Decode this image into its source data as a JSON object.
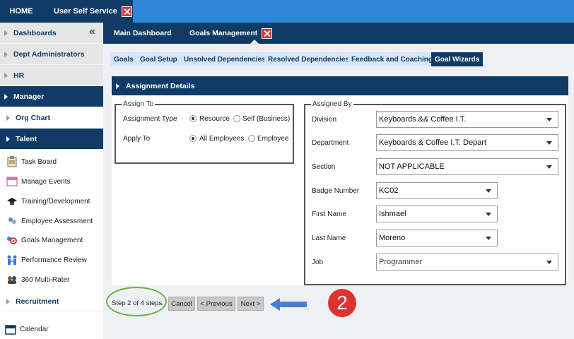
{
  "top": {
    "home": "HOME",
    "tab": "User Self Service"
  },
  "sidebar": {
    "sections": [
      "Dashboards",
      "Dept Administrators",
      "HR",
      "Manager",
      "Org Chart",
      "Talent"
    ],
    "talent_items": [
      "Task Board",
      "Manage Events",
      "Training/Development",
      "Employee Assessment",
      "Goals Management",
      "Performance Review",
      "360 Multi-Rater"
    ],
    "recruitment": "Recruitment",
    "calendar": "Calendar"
  },
  "subtabs": {
    "main": "Main Dashboard",
    "goals": "Goals Management"
  },
  "pills": [
    "Goals",
    "Goal Setup",
    "Unsolved Dependencies",
    "Resolved Dependencies",
    "Feedback and Coaching",
    "Goal Wizards"
  ],
  "panel": {
    "title": "Assignment Details",
    "assign_to": {
      "legend": "Assign To",
      "type_label": "Assignment Type",
      "type_opt1": "Resource",
      "type_opt2": "Self (Business)",
      "apply_label": "Apply To",
      "apply_opt1": "All Employees",
      "apply_opt2": "Employee"
    },
    "assigned_by": {
      "legend": "Assigned By",
      "division_label": "Division",
      "division": "Keyboards && Coffee I.T.",
      "department_label": "Department",
      "department": "Keyboards & Coffee I.T. Depart",
      "section_label": "Section",
      "section": "NOT APPLICABLE",
      "badge_label": "Badge Number",
      "badge": "KC02",
      "first_label": "First Name",
      "first": "Ishmael",
      "last_label": "Last Name",
      "last": "Moreno",
      "job_label": "Job",
      "job": "Programmer"
    }
  },
  "wizard": {
    "step": "Step 2 of 4 steps.",
    "cancel": "Cancel",
    "previous": "< Previous",
    "next": "Next >",
    "badge": "2"
  },
  "colors": {
    "navy": "#0f3b66",
    "blue": "#2e86d6",
    "red": "#e03131",
    "green": "#6cb33f"
  }
}
